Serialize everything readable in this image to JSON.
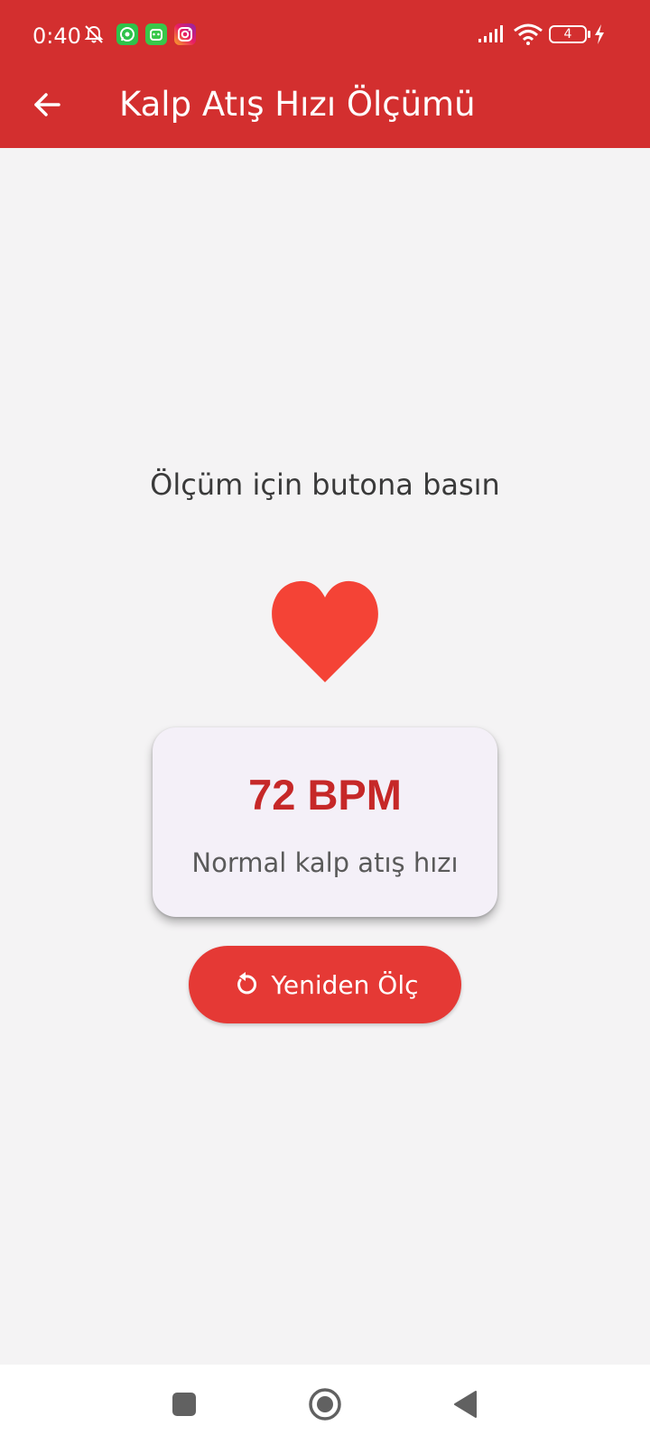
{
  "status_bar": {
    "time": "0:40",
    "battery_level": "4",
    "icons": [
      "alarm-off-icon",
      "whatsapp-icon",
      "android-app-icon",
      "instagram-icon",
      "signal-icon",
      "wifi-icon",
      "battery-icon",
      "charging-icon"
    ]
  },
  "app_bar": {
    "title": "Kalp Atış Hızı Ölçümü",
    "back_icon": "arrow-back-icon"
  },
  "main": {
    "instruction": "Ölçüm için butona basın",
    "heart_icon": "heart-icon",
    "result": {
      "bpm": "72 BPM",
      "status": "Normal kalp atış hızı"
    },
    "remeasure_button": {
      "label": "Yeniden Ölç",
      "icon": "refresh-icon"
    }
  },
  "nav_bar": {
    "buttons": [
      "recents-square-icon",
      "home-circle-icon",
      "back-triangle-icon"
    ]
  },
  "colors": {
    "app_bar": "#d32f2f",
    "heart": "#f44336",
    "bpm_text": "#c62828",
    "button": "#e53935",
    "background": "#f4f3f4",
    "card": "#f4f0f8"
  }
}
